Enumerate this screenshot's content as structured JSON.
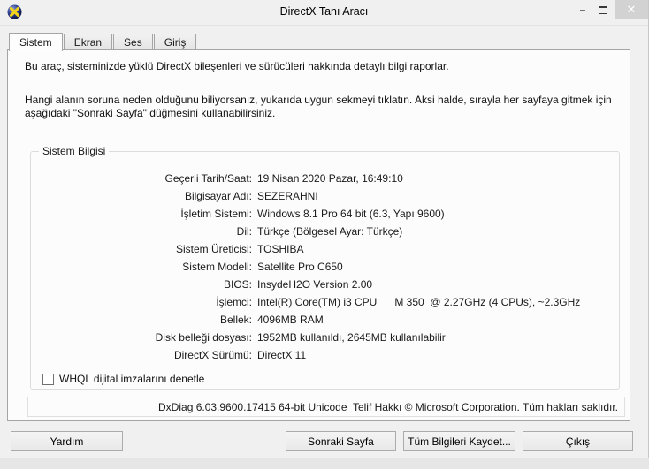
{
  "window": {
    "title": "DirectX Tanı Aracı",
    "icons": {
      "minimize_glyph": "–",
      "close_glyph": "✕"
    }
  },
  "tabs": [
    {
      "label": "Sistem",
      "active": true
    },
    {
      "label": "Ekran",
      "active": false
    },
    {
      "label": "Ses",
      "active": false
    },
    {
      "label": "Giriş",
      "active": false
    }
  ],
  "intro": {
    "paragraph1": "Bu araç, sisteminizde yüklü DirectX bileşenleri ve sürücüleri hakkında detaylı bilgi raporlar.",
    "paragraph2": "Hangi alanın soruna neden olduğunu biliyorsanız, yukarıda uygun sekmeyi tıklatın.  Aksi halde, sırayla her sayfaya gitmek için aşağıdaki \"Sonraki Sayfa\" düğmesini kullanabilirsiniz."
  },
  "system_info": {
    "group_title": "Sistem Bilgisi",
    "rows": [
      {
        "label": "Geçerli Tarih/Saat:",
        "value": "19 Nisan 2020 Pazar, 16:49:10"
      },
      {
        "label": "Bilgisayar Adı:",
        "value": "SEZERAHNI"
      },
      {
        "label": "İşletim Sistemi:",
        "value": "Windows 8.1 Pro 64 bit (6.3, Yapı 9600)"
      },
      {
        "label": "Dil:",
        "value": "Türkçe (Bölgesel Ayar: Türkçe)"
      },
      {
        "label": "Sistem Üreticisi:",
        "value": "TOSHIBA"
      },
      {
        "label": "Sistem Modeli:",
        "value": "Satellite Pro C650"
      },
      {
        "label": "BIOS:",
        "value": "InsydeH2O Version 2.00"
      },
      {
        "label": "İşlemci:",
        "value": "Intel(R) Core(TM) i3 CPU      M 350  @ 2.27GHz (4 CPUs), ~2.3GHz"
      },
      {
        "label": "Bellek:",
        "value": "4096MB RAM"
      },
      {
        "label": "Disk belleği dosyası:",
        "value": "1952MB kullanıldı, 2645MB kullanılabilir"
      },
      {
        "label": "DirectX Sürümü:",
        "value": "DirectX 11"
      }
    ]
  },
  "whql": {
    "label": "WHQL dijital imzalarını denetle",
    "checked": false
  },
  "status_bar": {
    "text": "DxDiag 6.03.9600.17415 64-bit Unicode  Telif Hakkı © Microsoft Corporation. Tüm hakları saklıdır."
  },
  "buttons": {
    "help": "Yardım",
    "next": "Sonraki Sayfa",
    "save": "Tüm Bilgileri Kaydet...",
    "exit": "Çıkış"
  },
  "colors": {
    "window_bg": "#f0f0f0",
    "tabpage_bg": "#fcfcfc",
    "close_button_bg": "#d2d2d2",
    "directx_icon_yellow": "#f2d21a",
    "directx_icon_blue": "#1c2a7a"
  }
}
